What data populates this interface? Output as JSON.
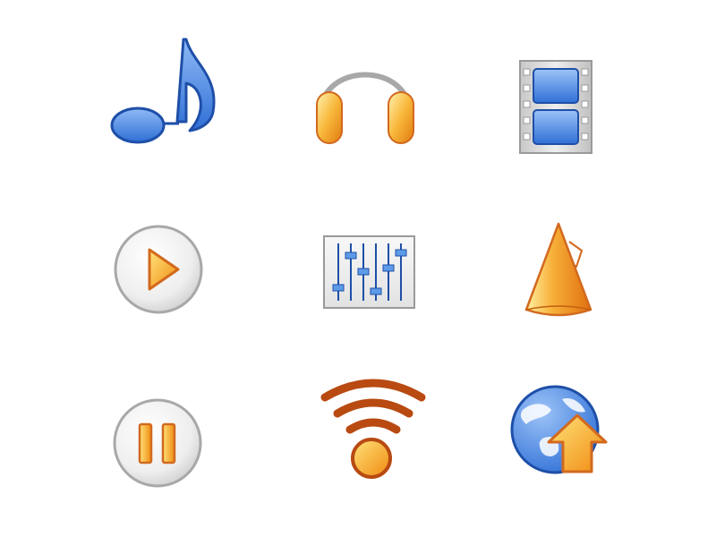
{
  "icons": [
    {
      "name": "music-note-icon"
    },
    {
      "name": "headphones-icon"
    },
    {
      "name": "film-strip-icon"
    },
    {
      "name": "play-button-icon"
    },
    {
      "name": "equalizer-sliders-icon"
    },
    {
      "name": "cone-speaker-icon"
    },
    {
      "name": "pause-button-icon"
    },
    {
      "name": "wireless-broadcast-icon"
    },
    {
      "name": "globe-upload-icon"
    }
  ],
  "colors": {
    "blue": "#3f7fe0",
    "blue_dark": "#1e4fa8",
    "orange": "#f5a623",
    "orange_dark": "#d2691e",
    "gray": "#a8a8a8",
    "rust": "#b84a12"
  }
}
